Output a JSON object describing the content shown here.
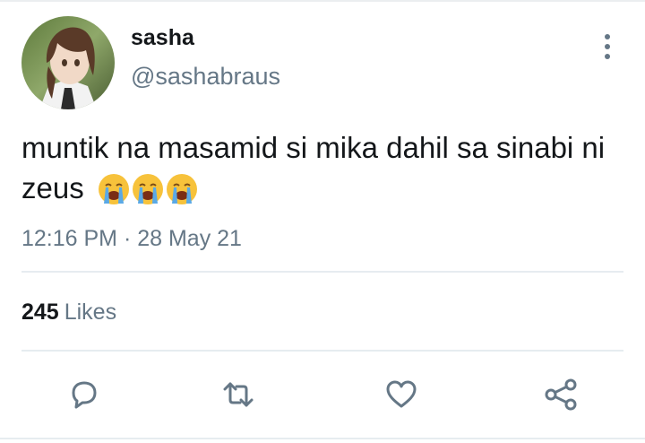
{
  "tweet": {
    "display_name": "sasha",
    "handle": "@sashabraus",
    "text": "muntik na masamid si mika dahil sa sinabi ni zeus",
    "emojis": [
      "loudly-crying-face",
      "loudly-crying-face",
      "loudly-crying-face"
    ],
    "timestamp": "12:16 PM · 28 May 21",
    "likes_count": "245",
    "likes_label": "Likes"
  },
  "actions": {
    "reply": "reply-icon",
    "retweet": "retweet-icon",
    "like": "heart-icon",
    "share": "share-icon"
  },
  "colors": {
    "text_primary": "#14171a",
    "text_secondary": "#657786",
    "divider": "#e6ecf0"
  }
}
